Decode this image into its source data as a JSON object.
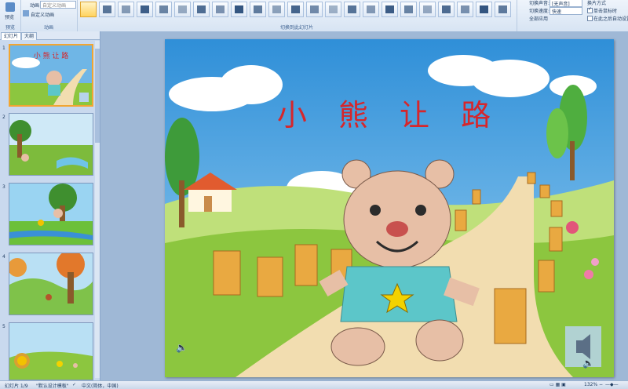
{
  "ribbon": {
    "preview_label": "预览",
    "sound_label": "动画",
    "custom_anim_label": "自定义动画",
    "custom_anim2_label": "自定义动画",
    "group_preview": "预览",
    "group_anim": "动画",
    "group_transition": "切换到此幻灯片",
    "sound_field_label": "切换声音:",
    "sound_value": "[无声音]",
    "speed_field_label": "切换速度:",
    "speed_value": "快速",
    "apply_all_label": "全部应用",
    "advance_label": "换片方式",
    "on_click_label": "单击鼠标时",
    "after_label": "在此之后自动设置"
  },
  "leftpane": {
    "tab_slides": "幻灯片",
    "tab_outline": "大纲",
    "slides": [
      {
        "num": "1",
        "title": "小 熊 让 路"
      },
      {
        "num": "2"
      },
      {
        "num": "3"
      },
      {
        "num": "4"
      },
      {
        "num": "5"
      }
    ]
  },
  "slide": {
    "title": "小 熊 让 路"
  },
  "status": {
    "slide_counter": "幻灯片 1/9",
    "theme": "\"默认设计模板\"",
    "language": "中文(简体，中国)",
    "zoom": "132%"
  },
  "colors": {
    "title_red": "#d6262b",
    "sky": "#5aa7df",
    "grass": "#8cc63f",
    "path": "#f2ddb0",
    "bear": "#e7bfa6",
    "shirt": "#5cc6c9"
  }
}
